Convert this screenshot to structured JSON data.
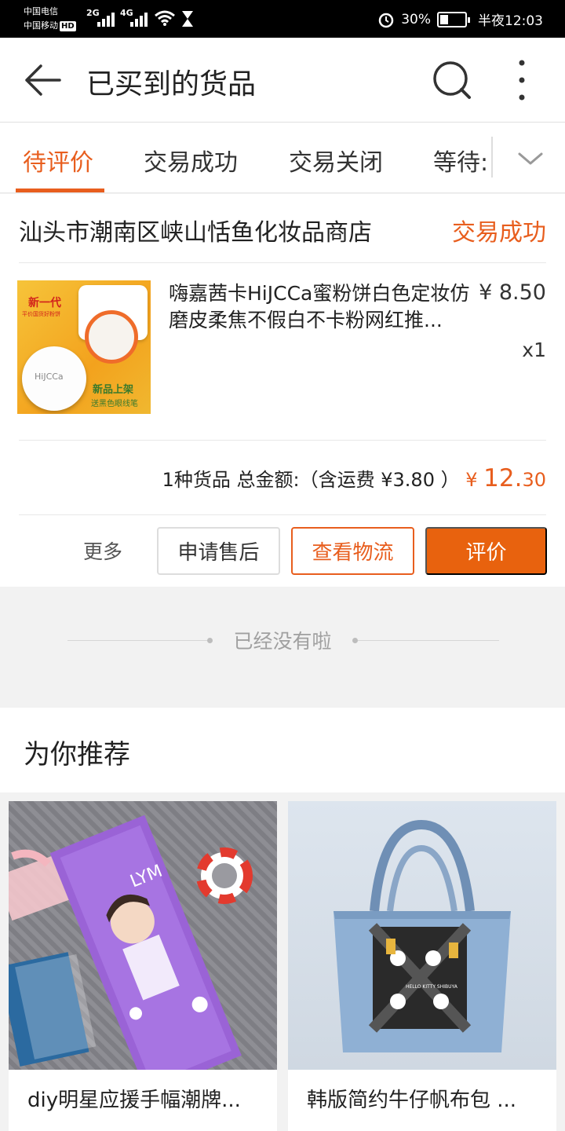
{
  "status_bar": {
    "carrier1": "中国电信",
    "carrier2": "中国移动",
    "hd": "HD",
    "sig1": "2G",
    "sig2": "4G",
    "battery": "30%",
    "time": "半夜12:03"
  },
  "header": {
    "title": "已买到的货品"
  },
  "tabs": [
    {
      "label": "待评价",
      "active": true
    },
    {
      "label": "交易成功"
    },
    {
      "label": "交易关闭"
    },
    {
      "label": "等待:"
    }
  ],
  "order": {
    "shop_name": "汕头市潮南区峡山恬鱼化妆品商店",
    "status": "交易成功",
    "item": {
      "title": "嗨嘉茜卡HiJCCa蜜粉饼白色定妆仿磨皮柔焦不假白不卡粉网红推...",
      "price": "¥ 8.50",
      "qty": "x1",
      "thumb_text": {
        "new_gen": "新一代",
        "sub": "平价国货好粉饼",
        "brand": "HiJCCa",
        "launch": "新品上架",
        "tagline": "送黑色眼线笔"
      }
    },
    "summary": {
      "label": "1种货品 总金额:（含运费 ¥3.80 ）",
      "currency": "¥ ",
      "total_int": "12.",
      "total_dec": "30"
    },
    "actions": {
      "more": "更多",
      "after_sale": "申请售后",
      "track": "查看物流",
      "rate": "评价"
    }
  },
  "end_text": "已经没有啦",
  "recommend": {
    "title": "为你推荐",
    "items": [
      {
        "title": "diy明星应援手幅潮牌..."
      },
      {
        "title": "韩版简约牛仔帆布包 ..."
      }
    ],
    "card1_img_text": {
      "lym": "LYM"
    },
    "card2_img_text": {
      "brand": "HELLO KITTY SHIBUYA"
    }
  },
  "colors": {
    "accent": "#e85e1e",
    "button": "#e8620e"
  }
}
